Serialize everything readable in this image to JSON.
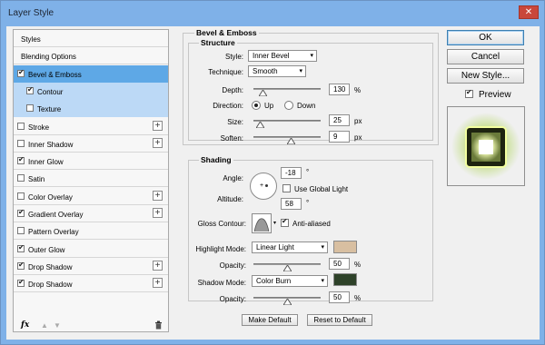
{
  "window": {
    "title": "Layer Style",
    "close_glyph": "✕"
  },
  "styles_list": {
    "items": [
      {
        "label": "Styles",
        "checkbox": false,
        "checked": false,
        "plus": false,
        "state": "header"
      },
      {
        "label": "Blending Options",
        "checkbox": false,
        "checked": false,
        "plus": false,
        "state": "header"
      },
      {
        "label": "Bevel & Emboss",
        "checkbox": true,
        "checked": true,
        "plus": false,
        "state": "selected"
      },
      {
        "label": "Contour",
        "checkbox": true,
        "checked": true,
        "plus": false,
        "state": "sub"
      },
      {
        "label": "Texture",
        "checkbox": true,
        "checked": false,
        "plus": false,
        "state": "sub"
      },
      {
        "label": "Stroke",
        "checkbox": true,
        "checked": false,
        "plus": true,
        "state": "normal"
      },
      {
        "label": "Inner Shadow",
        "checkbox": true,
        "checked": false,
        "plus": true,
        "state": "normal"
      },
      {
        "label": "Inner Glow",
        "checkbox": true,
        "checked": true,
        "plus": false,
        "state": "normal"
      },
      {
        "label": "Satin",
        "checkbox": true,
        "checked": false,
        "plus": false,
        "state": "normal"
      },
      {
        "label": "Color Overlay",
        "checkbox": true,
        "checked": false,
        "plus": true,
        "state": "normal"
      },
      {
        "label": "Gradient Overlay",
        "checkbox": true,
        "checked": true,
        "plus": true,
        "state": "normal"
      },
      {
        "label": "Pattern Overlay",
        "checkbox": true,
        "checked": false,
        "plus": false,
        "state": "normal"
      },
      {
        "label": "Outer Glow",
        "checkbox": true,
        "checked": true,
        "plus": false,
        "state": "normal"
      },
      {
        "label": "Drop Shadow",
        "checkbox": true,
        "checked": true,
        "plus": true,
        "state": "normal"
      },
      {
        "label": "Drop Shadow",
        "checkbox": true,
        "checked": true,
        "plus": true,
        "state": "normal"
      }
    ],
    "footer": {
      "fx_label": "fx",
      "up_glyph": "▲",
      "down_glyph": "▼",
      "trash_glyph": "🗑"
    }
  },
  "bevel": {
    "section_title": "Bevel & Emboss",
    "structure_title": "Structure",
    "style_label": "Style:",
    "style_value": "Inner Bevel",
    "technique_label": "Technique:",
    "technique_value": "Smooth",
    "depth_label": "Depth:",
    "depth_value": "130",
    "depth_unit": "%",
    "depth_level": 0.13,
    "direction_label": "Direction:",
    "direction_up": "Up",
    "direction_down": "Down",
    "size_label": "Size:",
    "size_value": "25",
    "size_unit": "px",
    "size_level": 0.1,
    "soften_label": "Soften:",
    "soften_value": "9",
    "soften_unit": "px",
    "soften_level": 0.55
  },
  "shading": {
    "title": "Shading",
    "angle_label": "Angle:",
    "angle_value": "-18",
    "angle_unit": "°",
    "altitude_label": "Altitude:",
    "altitude_value": "58",
    "altitude_unit": "°",
    "global_light_label": "Use Global Light",
    "gloss_label": "Gloss Contour:",
    "anti_aliased_label": "Anti-aliased",
    "highlight_mode_label": "Highlight Mode:",
    "highlight_mode_value": "Linear Light",
    "highlight_color": "#d8bfa1",
    "highlight_opacity_label": "Opacity:",
    "highlight_opacity_value": "50",
    "highlight_opacity_unit": "%",
    "highlight_opacity_level": 0.5,
    "shadow_mode_label": "Shadow Mode:",
    "shadow_mode_value": "Color Burn",
    "shadow_color": "#2e4229",
    "shadow_opacity_label": "Opacity:",
    "shadow_opacity_value": "50",
    "shadow_opacity_unit": "%",
    "shadow_opacity_level": 0.5
  },
  "buttons": {
    "make_default": "Make Default",
    "reset_default": "Reset to Default",
    "ok": "OK",
    "cancel": "Cancel",
    "new_style": "New Style...",
    "preview_label": "Preview"
  },
  "colors": {
    "accent_selected": "#5ea8e6",
    "accent_sub": "#bcd9f6",
    "titlebar": "#7fb1e8"
  }
}
